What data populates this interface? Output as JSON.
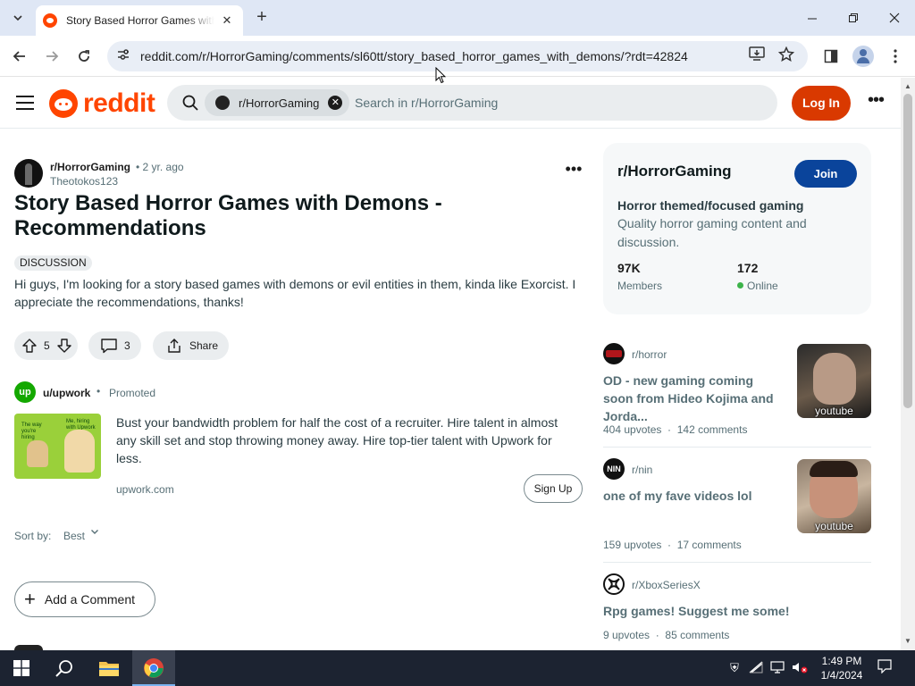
{
  "browser": {
    "tab_title": "Story Based Horror Games with D",
    "url": "reddit.com/r/HorrorGaming/comments/sl60tt/story_based_horror_games_with_demons/?rdt=42824"
  },
  "header": {
    "logo_text": "reddit",
    "search_chip": "r/HorrorGaming",
    "search_placeholder": "Search in r/HorrorGaming",
    "login_label": "Log In"
  },
  "post": {
    "subreddit": "r/HorrorGaming",
    "age": "• 2 yr. ago",
    "author": "Theotokos123",
    "title": "Story Based Horror Games with Demons - Recommendations",
    "flair": "DISCUSSION",
    "body": "Hi guys, I'm looking for a story based games with demons or evil entities in them, kinda like Exorcist. I appreciate the recommendations, thanks!",
    "votes": "5",
    "comments": "3",
    "share_label": "Share"
  },
  "promoted": {
    "user": "u/upwork",
    "dot": "•",
    "tag": "Promoted",
    "logo_text": "up",
    "image_text_left": "The way you're hiring",
    "image_text_right": "Me, hiring with Upwork",
    "text": "Bust your bandwidth problem for half the cost of a recruiter. Hire talent in almost any skill set and stop throwing money away. Hire top-tier talent with Upwork for less.",
    "domain": "upwork.com",
    "cta": "Sign Up"
  },
  "sort": {
    "label": "Sort by:",
    "value": "Best"
  },
  "add_comment_label": "Add a Comment",
  "sidebar": {
    "name": "r/HorrorGaming",
    "join_label": "Join",
    "tagline": "Horror themed/focused gaming",
    "description": "Quality horror gaming content and discussion.",
    "members_count": "97K",
    "members_label": "Members",
    "online_count": "172",
    "online_label": "Online"
  },
  "related": [
    {
      "sub": "r/horror",
      "title": "OD - new gaming coming soon from Hideo Kojima and Jorda...",
      "upvotes": "404 upvotes",
      "comments": "142 comments",
      "thumb_label": "youtube"
    },
    {
      "sub": "r/nin",
      "title": "one of my fave videos lol",
      "upvotes": "159 upvotes",
      "comments": "17 comments",
      "thumb_label": "youtube"
    },
    {
      "sub": "r/XboxSeriesX",
      "title": "Rpg games! Suggest me some!",
      "upvotes": "9 upvotes",
      "comments": "85 comments"
    }
  ],
  "taskbar": {
    "time": "1:49 PM",
    "date": "1/4/2024"
  },
  "colors": {
    "reddit_orange": "#ff4500",
    "login_red": "#d93900",
    "join_blue": "#0a449b",
    "online_green": "#3cb34a"
  }
}
